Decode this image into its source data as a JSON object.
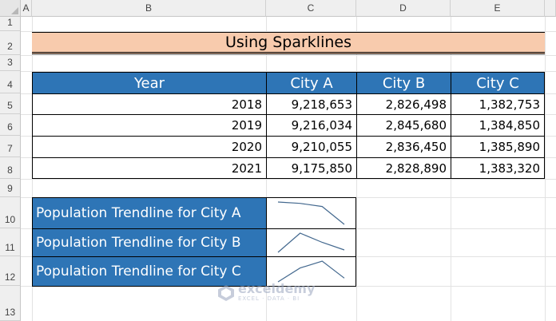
{
  "columns": [
    "A",
    "B",
    "C",
    "D",
    "E"
  ],
  "rows": [
    "1",
    "2",
    "3",
    "4",
    "5",
    "6",
    "7",
    "8",
    "9",
    "10",
    "11",
    "12",
    "13"
  ],
  "title": "Using Sparklines",
  "table": {
    "headers": [
      "Year",
      "City A",
      "City B",
      "City C"
    ],
    "data": [
      [
        "2018",
        "9,218,653",
        "2,826,498",
        "1,382,753"
      ],
      [
        "2019",
        "9,216,034",
        "2,845,680",
        "1,384,850"
      ],
      [
        "2020",
        "9,210,055",
        "2,836,450",
        "1,385,890"
      ],
      [
        "2021",
        "9,175,850",
        "2,828,890",
        "1,383,320"
      ]
    ]
  },
  "sparklines": [
    {
      "label": "Population Trendline for City A",
      "values": [
        9218653,
        9216034,
        9210055,
        9175850
      ]
    },
    {
      "label": "Population Trendline for City B",
      "values": [
        2826498,
        2845680,
        2836450,
        2828890
      ]
    },
    {
      "label": "Population Trendline for City C",
      "values": [
        1382753,
        1384850,
        1385890,
        1383320
      ]
    }
  ],
  "sparkline_color": "#44698f",
  "header_fill": "#2e75b6",
  "title_fill": "#f8cbad",
  "watermark": {
    "name": "exceldemy",
    "tagline": "EXCEL · DATA · BI"
  }
}
